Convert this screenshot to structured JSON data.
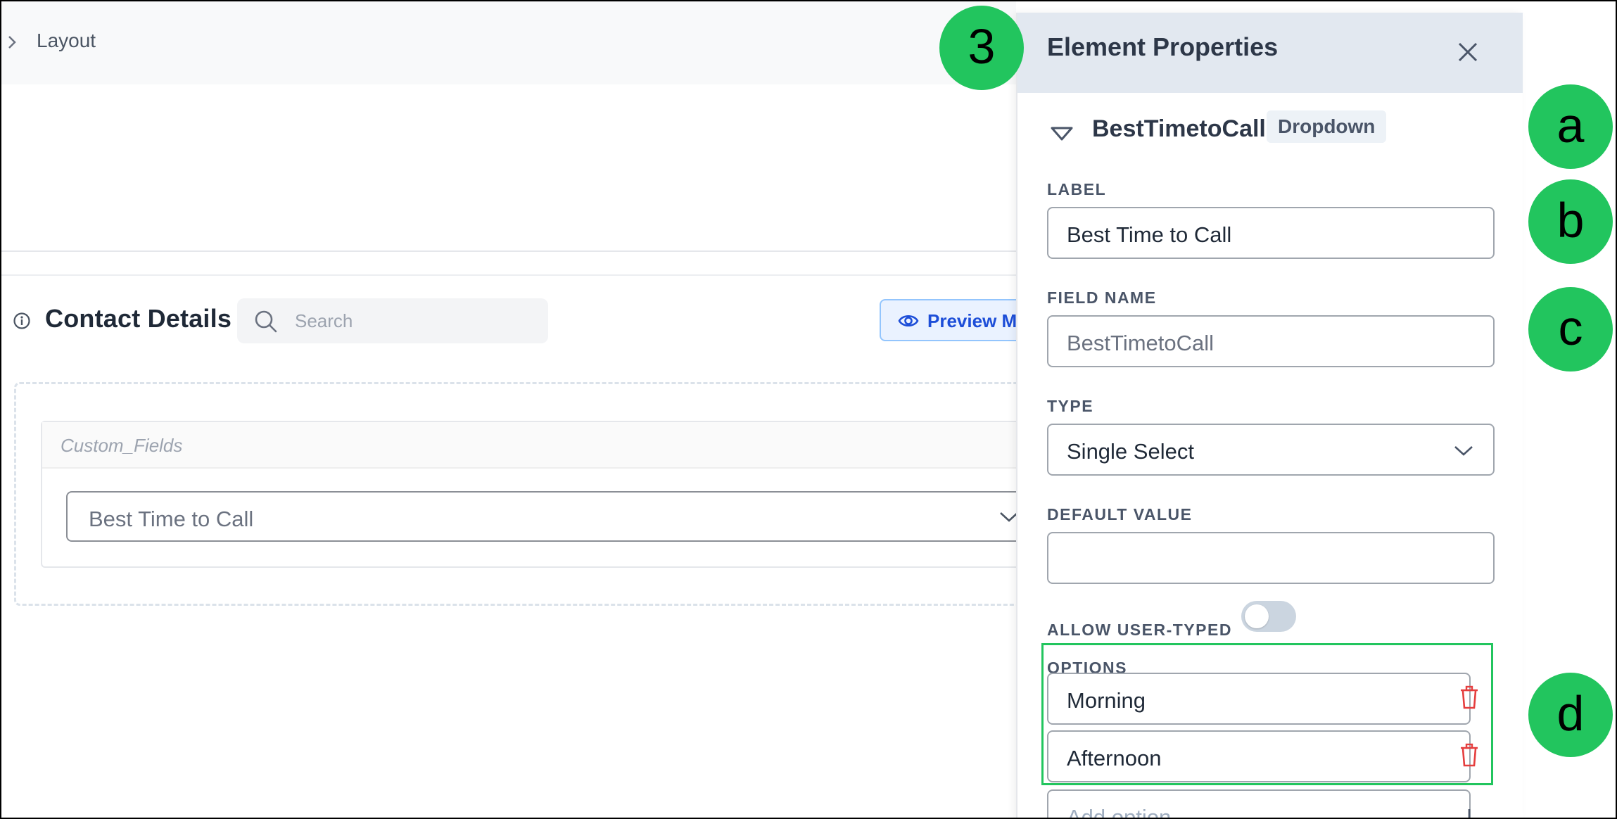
{
  "layout_bar": {
    "title": "Layout"
  },
  "section": {
    "title": "Contact Details",
    "search_placeholder": "Search",
    "preview_button": "Preview M"
  },
  "card": {
    "header": "Custom_Fields",
    "select_value": "Best Time to Call"
  },
  "panel": {
    "title": "Element Properties",
    "element_name": "BestTimetoCall",
    "element_type_badge": "Dropdown",
    "label": {
      "label": "LABEL",
      "value": "Best Time to Call"
    },
    "field_name": {
      "label": "FIELD NAME",
      "value": "BestTimetoCall"
    },
    "type": {
      "label": "TYPE",
      "value": "Single Select"
    },
    "default_value": {
      "label": "DEFAULT VALUE",
      "value": ""
    },
    "allow_user_typed": {
      "label": "ALLOW USER-TYPED",
      "enabled": false
    },
    "options": {
      "label": "OPTIONS",
      "items": [
        "Morning",
        "Afternoon"
      ],
      "add_placeholder": "Add option"
    }
  },
  "callouts": [
    "3",
    "a",
    "b",
    "c",
    "d"
  ],
  "colors": {
    "callout_green": "#22c55e",
    "panel_header_bg": "#e2e8f0",
    "preview_blue": "#1d4ed8",
    "trash_red": "#e53e3e"
  },
  "icons": [
    "chevron-right-icon",
    "info-icon",
    "search-icon",
    "eye-icon",
    "chevron-down-icon",
    "close-icon",
    "triangle-down-icon",
    "trash-icon",
    "plus-icon"
  ]
}
